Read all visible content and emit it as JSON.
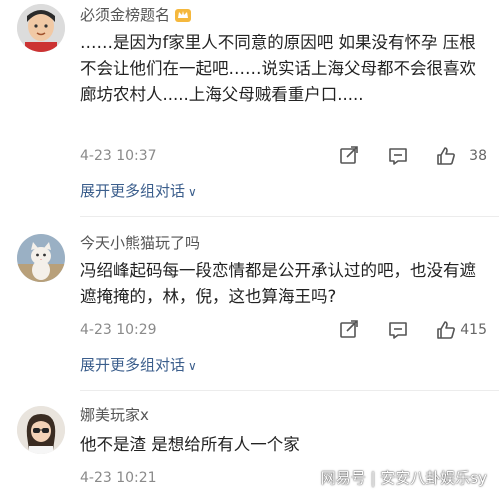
{
  "comments": [
    {
      "username": "必须金榜题名",
      "text": "……是因为f家里人不同意的原因吧 如果没有怀孕 压根不会让他们在一起吧……说实话上海父母都不会很喜欢廊坊农村人.....上海父母贼看重户口.....",
      "time": "4-23 10:37",
      "likes": "38",
      "expand_label": "展开更多组对话",
      "avatar_icon": "boy-avatar"
    },
    {
      "username": "今天小熊猫玩了吗",
      "text": "冯绍峰起码每一段恋情都是公开承认过的吧，也没有遮遮掩掩的，林，倪，这也算海王吗?",
      "time": "4-23 10:29",
      "likes": "415",
      "expand_label": "展开更多组对话",
      "avatar_icon": "cat-avatar"
    },
    {
      "username": "娜美玩家x",
      "text": "他不是渣 是想给所有人一个家",
      "time": "4-23 10:21",
      "avatar_icon": "girl-avatar"
    }
  ],
  "watermark": "网易号 | 安安八卦娱乐sy",
  "colors": {
    "link": "#3b5e8c",
    "meta": "#8a8a8a",
    "username": "#555555"
  }
}
